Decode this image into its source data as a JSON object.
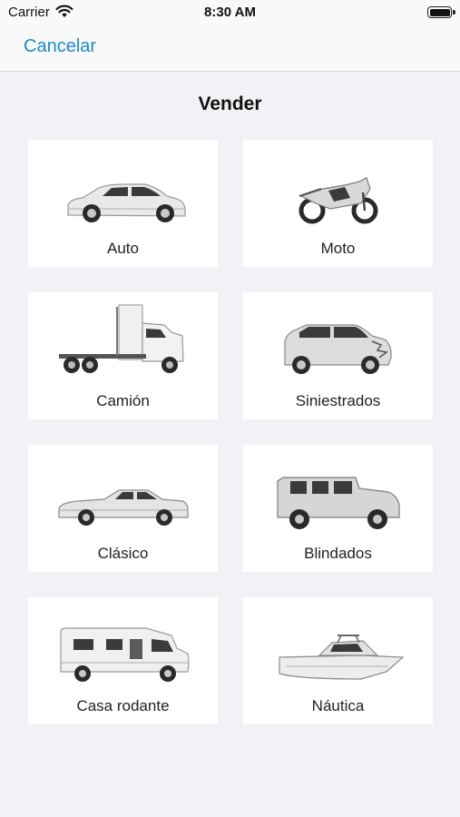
{
  "status_bar": {
    "carrier": "Carrier",
    "time": "8:30 AM",
    "icons": [
      "wifi-icon",
      "battery-icon"
    ]
  },
  "nav": {
    "cancel_label": "Cancelar"
  },
  "page": {
    "title": "Vender"
  },
  "categories": [
    {
      "label": "Auto",
      "icon": "sedan-car-icon"
    },
    {
      "label": "Moto",
      "icon": "motorcycle-icon"
    },
    {
      "label": "Camión",
      "icon": "truck-icon"
    },
    {
      "label": "Siniestrados",
      "icon": "damaged-suv-icon"
    },
    {
      "label": "Clásico",
      "icon": "classic-car-icon"
    },
    {
      "label": "Blindados",
      "icon": "armored-jeep-icon"
    },
    {
      "label": "Casa rodante",
      "icon": "motorhome-icon"
    },
    {
      "label": "Náutica",
      "icon": "boat-icon"
    }
  ],
  "colors": {
    "accent": "#1b8ad2",
    "background": "#f2f2f6",
    "card": "#ffffff"
  }
}
